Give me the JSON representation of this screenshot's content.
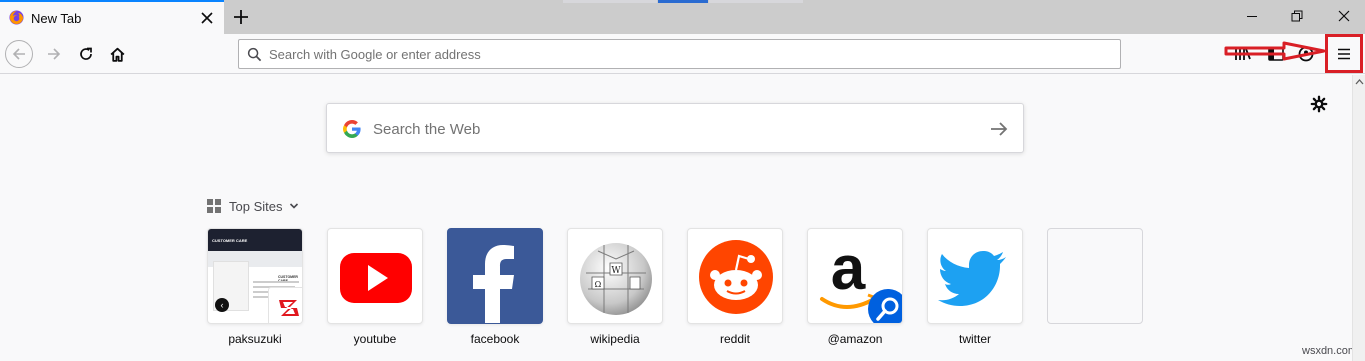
{
  "tab": {
    "title": "New Tab"
  },
  "urlbar": {
    "placeholder": "Search with Google or enter address"
  },
  "websearch": {
    "placeholder": "Search the Web"
  },
  "top_sites": {
    "label": "Top Sites",
    "tiles": [
      {
        "name": "paksuzuki",
        "icon": "paksuzuki-screenshot"
      },
      {
        "name": "youtube",
        "icon": "youtube-logo"
      },
      {
        "name": "facebook",
        "icon": "facebook-logo"
      },
      {
        "name": "wikipedia",
        "icon": "wikipedia-globe"
      },
      {
        "name": "reddit",
        "icon": "reddit-logo"
      },
      {
        "name": "@amazon",
        "icon": "amazon-logo"
      },
      {
        "name": "twitter",
        "icon": "twitter-bird"
      },
      {
        "name": "",
        "icon": "empty"
      }
    ]
  },
  "thumbnail": {
    "heading": "CUSTOMER CARE",
    "subheading": "CUSTOMER CARE"
  },
  "watermark": "wsxdn.com",
  "colors": {
    "accent": "#0a84ff",
    "annotation": "#d91f26",
    "youtube": "#ff0000",
    "facebook": "#3b5998",
    "reddit": "#ff4500",
    "twitter": "#1da1f2"
  }
}
